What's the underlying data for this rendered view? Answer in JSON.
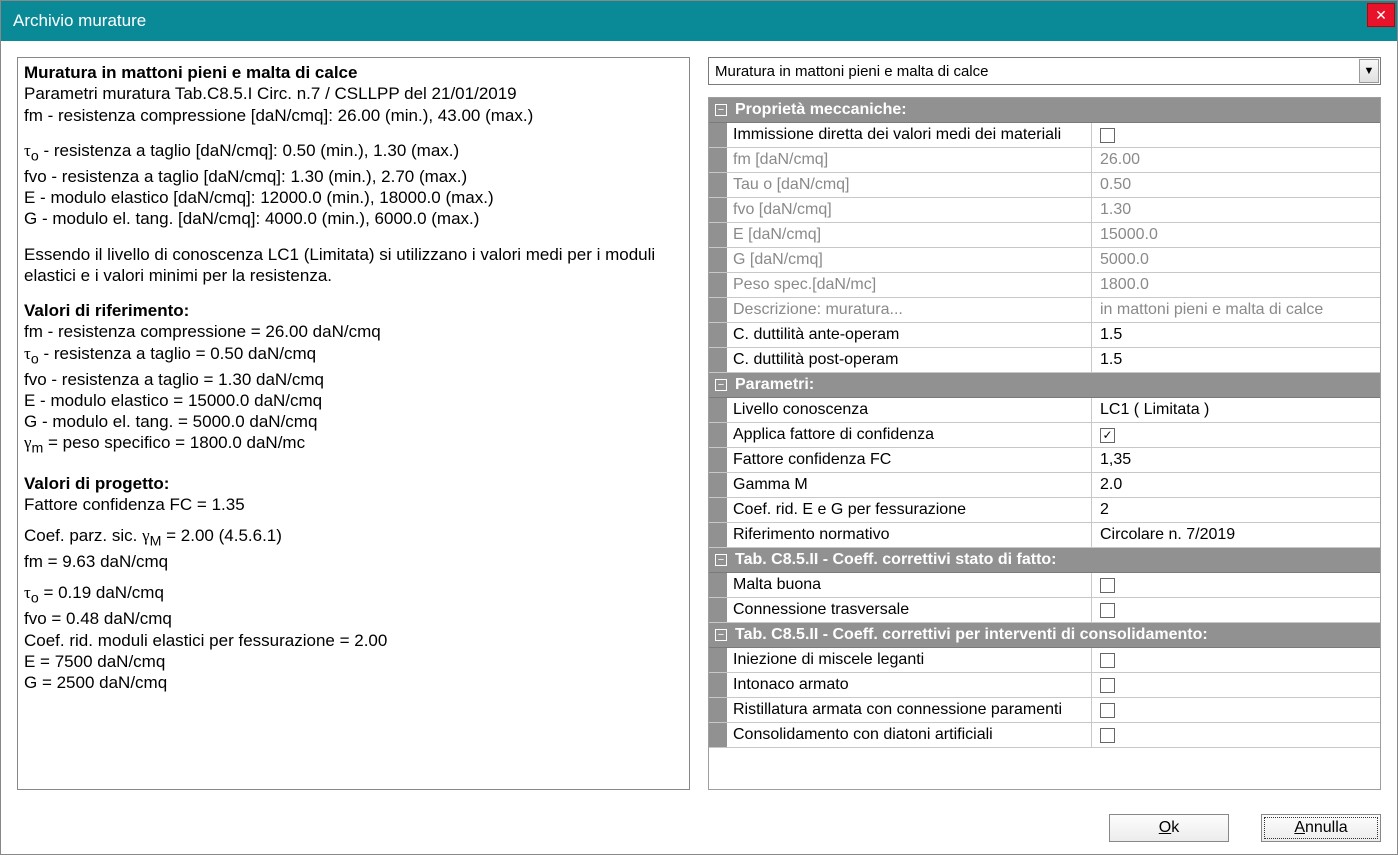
{
  "title": "Archivio murature",
  "dropdown_selected": "Muratura in mattoni pieni e malta di calce",
  "left": {
    "heading": "Muratura in mattoni pieni e malta di calce",
    "l1": "Parametri muratura Tab.C8.5.I Circ. n.7 / CSLLPP del 21/01/2019",
    "l2": "fm - resistenza compressione [daN/cmq]: 26.00 (min.),  43.00 (max.)",
    "l3_pre": " - resistenza a taglio [daN/cmq]: 0.50 (min.),  1.30 (max.)",
    "l4": "fvo - resistenza a taglio [daN/cmq]: 1.30 (min.),  2.70 (max.)",
    "l5": "E - modulo elastico [daN/cmq]: 12000.0 (min.),  18000.0 (max.)",
    "l6": "G - modulo el. tang. [daN/cmq]: 4000.0 (min.),  6000.0 (max.)",
    "l7": "Essendo il livello di conoscenza LC1 (Limitata) si utilizzano i valori medi per i moduli elastici e i valori minimi per la resistenza.",
    "h2": "Valori di riferimento:",
    "r1": "fm - resistenza compressione = 26.00 daN/cmq",
    "r2": " - resistenza a taglio = 0.50 daN/cmq",
    "r3": "fvo - resistenza a taglio = 1.30 daN/cmq",
    "r4": "E - modulo elastico = 15000.0 daN/cmq",
    "r5": "G - modulo el. tang. = 5000.0 daN/cmq",
    "r6": " = peso specifico = 1800.0 daN/mc",
    "h3": "Valori di progetto:",
    "p1": "Fattore confidenza FC = 1.35",
    "p2": " = 2.00   (4.5.6.1)",
    "p3": "fm = 9.63  daN/cmq",
    "p4": " = 0.19  daN/cmq",
    "p5": "fvo = 0.48  daN/cmq",
    "p6": "Coef. rid. moduli elastici per fessurazione = 2.00",
    "p7": "E = 7500  daN/cmq",
    "p8": "G = 2500  daN/cmq"
  },
  "sections": {
    "mech": {
      "title": "Proprietà meccaniche:",
      "rows": [
        {
          "label": "Immissione diretta dei valori medi dei materiali",
          "type": "check",
          "checked": false
        },
        {
          "label": "fm  [daN/cmq]",
          "value": "26.00",
          "disabled": true
        },
        {
          "label": "Tau o  [daN/cmq]",
          "value": "0.50",
          "disabled": true
        },
        {
          "label": "fvo  [daN/cmq]",
          "value": "1.30",
          "disabled": true
        },
        {
          "label": "E   [daN/cmq]",
          "value": "15000.0",
          "disabled": true
        },
        {
          "label": "G   [daN/cmq]",
          "value": "5000.0",
          "disabled": true
        },
        {
          "label": "Peso spec.[daN/mc]",
          "value": "1800.0",
          "disabled": true
        },
        {
          "label": "Descrizione: muratura...",
          "value": "in mattoni pieni e malta di calce",
          "disabled": true
        },
        {
          "label": "C. duttilità ante-operam",
          "value": "1.5"
        },
        {
          "label": "C. duttilità post-operam",
          "value": "1.5"
        }
      ]
    },
    "params": {
      "title": "Parametri:",
      "rows": [
        {
          "label": "Livello conoscenza",
          "value": "LC1 ( Limitata )"
        },
        {
          "label": "Applica fattore di confidenza",
          "type": "check",
          "checked": true
        },
        {
          "label": "Fattore confidenza FC",
          "value": "1,35"
        },
        {
          "label": "Gamma M",
          "value": "2.0"
        },
        {
          "label": "Coef. rid. E e G per fessurazione",
          "value": "2"
        },
        {
          "label": "Riferimento normativo",
          "value": "Circolare n. 7/2019"
        }
      ]
    },
    "stato": {
      "title": "Tab. C8.5.II - Coeff. correttivi stato di fatto:",
      "rows": [
        {
          "label": "Malta buona",
          "type": "check",
          "checked": false
        },
        {
          "label": "Connessione trasversale",
          "type": "check",
          "checked": false
        }
      ]
    },
    "cons": {
      "title": "Tab. C8.5.II - Coeff. correttivi per interventi di consolidamento:",
      "rows": [
        {
          "label": "Iniezione di miscele leganti",
          "type": "check",
          "checked": false
        },
        {
          "label": "Intonaco armato",
          "type": "check",
          "checked": false
        },
        {
          "label": "Ristillatura armata con connessione paramenti",
          "type": "check",
          "checked": false
        },
        {
          "label": "Consolidamento con diatoni artificiali",
          "type": "check",
          "checked": false
        }
      ]
    }
  },
  "buttons": {
    "ok": "Ok",
    "cancel": "Annulla"
  }
}
